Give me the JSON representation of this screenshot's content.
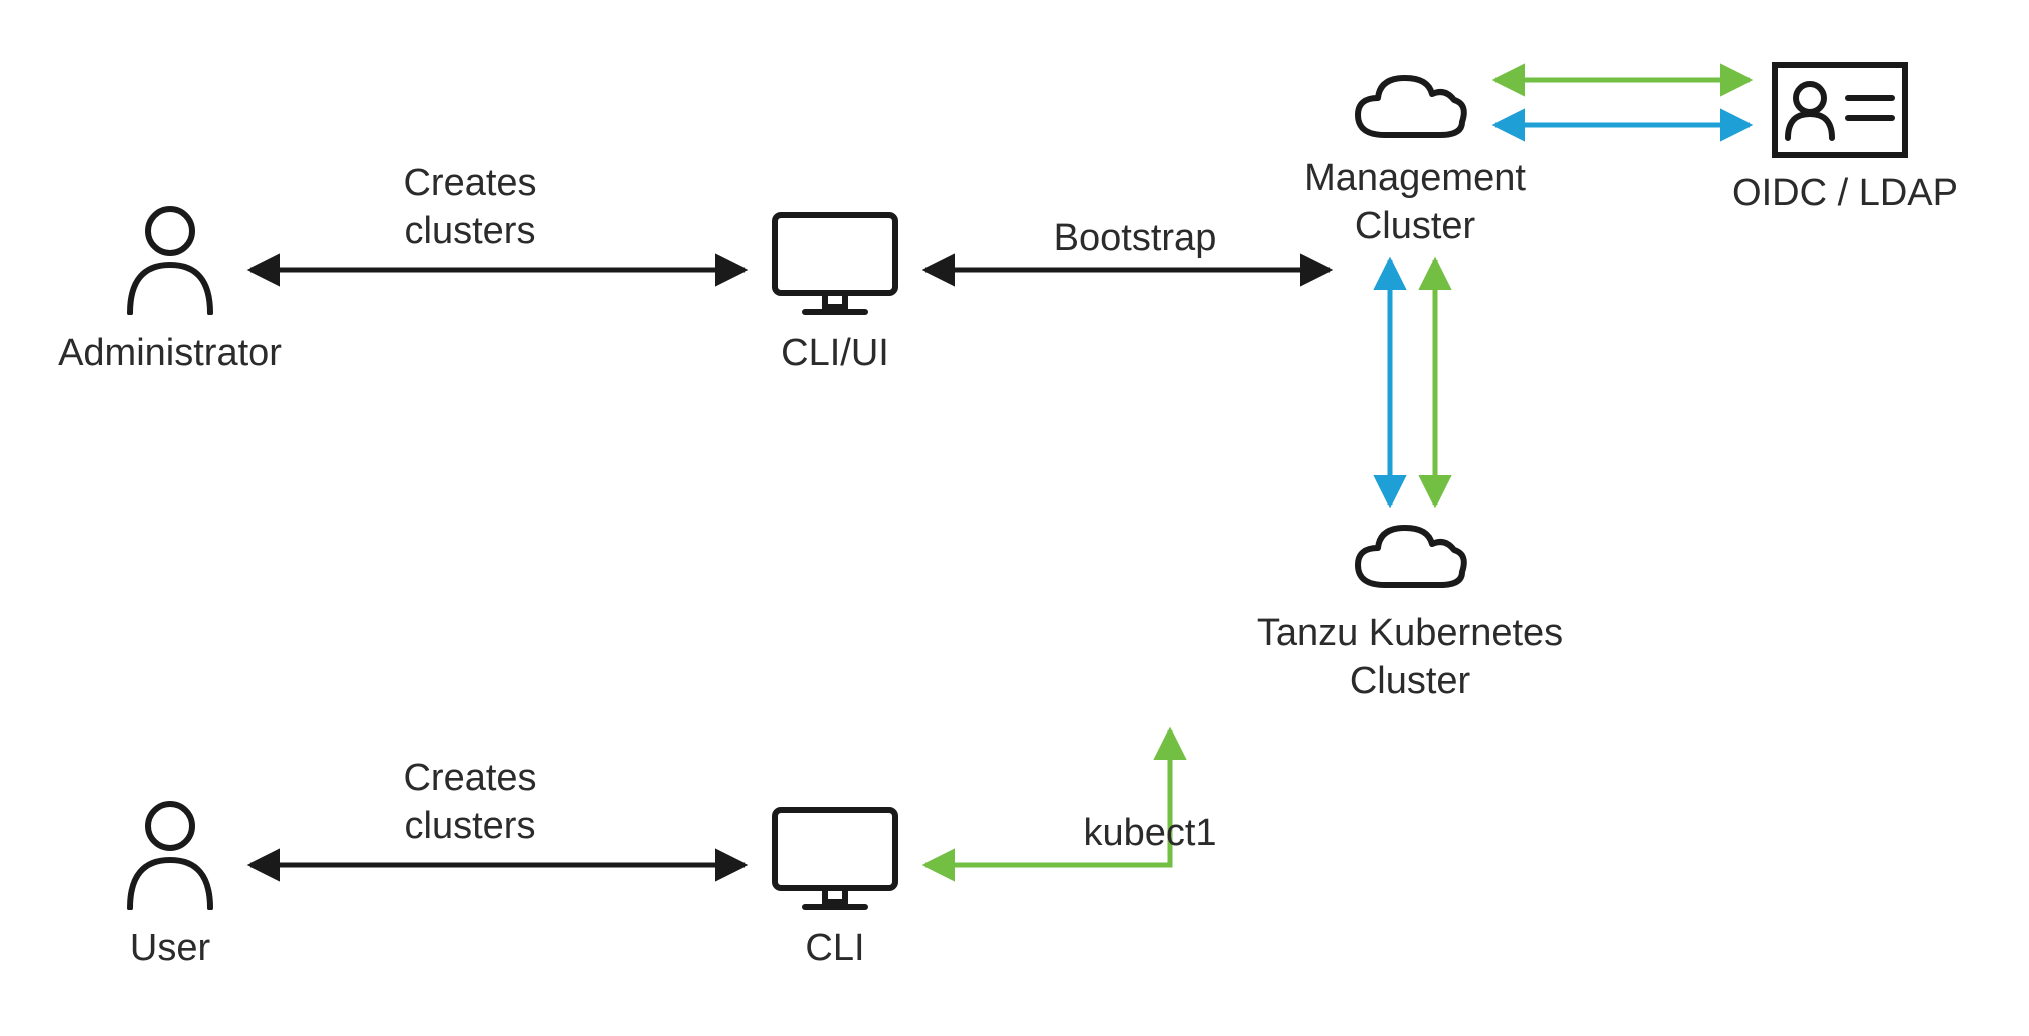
{
  "colors": {
    "black": "#1a1a1a",
    "blue": "#1E9FD6",
    "green": "#72BF44"
  },
  "nodes": {
    "administrator": {
      "label": "Administrator"
    },
    "user": {
      "label": "User"
    },
    "cli_ui_top": {
      "label": "CLI/UI"
    },
    "cli_bottom": {
      "label": "CLI"
    },
    "mgmt_cluster": {
      "label": "Management\nCluster"
    },
    "tkc": {
      "label": "Tanzu Kubernetes\nCluster"
    },
    "oidc_ldap": {
      "label": "OIDC / LDAP"
    }
  },
  "edge_labels": {
    "creates_clusters_top": "Creates\nclusters",
    "bootstrap": "Bootstrap",
    "creates_clusters_bottom": "Creates\nclusters",
    "kubectl": "kubect1"
  }
}
